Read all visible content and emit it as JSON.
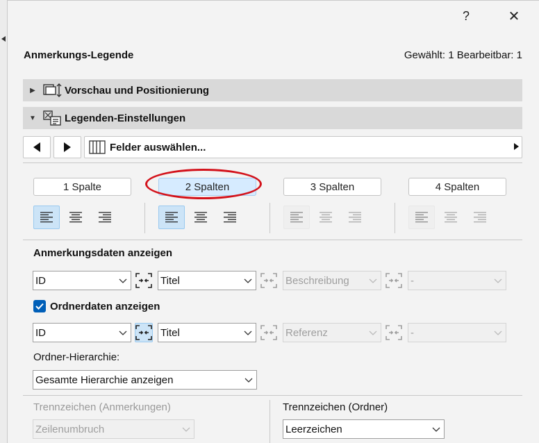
{
  "window": {
    "help_label": "?",
    "close_label": "✕"
  },
  "header": {
    "title": "Anmerkungs-Legende",
    "status": "Gewählt: 1 Bearbeitbar: 1"
  },
  "sections": {
    "preview": "Vorschau und Positionierung",
    "settings": "Legenden-Einstellungen"
  },
  "field_selector": {
    "label": "Felder auswählen..."
  },
  "columns": [
    {
      "label": "1 Spalte",
      "selected": false,
      "enabled": true
    },
    {
      "label": "2 Spalten",
      "selected": true,
      "enabled": true
    },
    {
      "label": "3 Spalten",
      "selected": false,
      "enabled": false
    },
    {
      "label": "4 Spalten",
      "selected": false,
      "enabled": false
    }
  ],
  "annotation_data": {
    "heading": "Anmerkungsdaten anzeigen",
    "fields": [
      "ID",
      "Titel",
      "Beschreibung",
      "-"
    ]
  },
  "folder_data": {
    "heading": "Ordnerdaten anzeigen",
    "checked": true,
    "fields": [
      "ID",
      "Titel",
      "Referenz",
      "-"
    ]
  },
  "hierarchy": {
    "label": "Ordner-Hierarchie:",
    "value": "Gesamte Hierarchie anzeigen"
  },
  "separators": {
    "annotations_label": "Trennzeichen (Anmerkungen)",
    "annotations_value": "Zeilenumbruch",
    "folder_label": "Trennzeichen (Ordner)",
    "folder_value": "Leerzeichen"
  },
  "icons": {
    "align_left": "align-left-icon",
    "align_center": "align-center-icon",
    "align_right": "align-right-icon",
    "link": "link-fields-icon",
    "highlight_color": "#d3121b",
    "accent_color": "#005fb8"
  }
}
